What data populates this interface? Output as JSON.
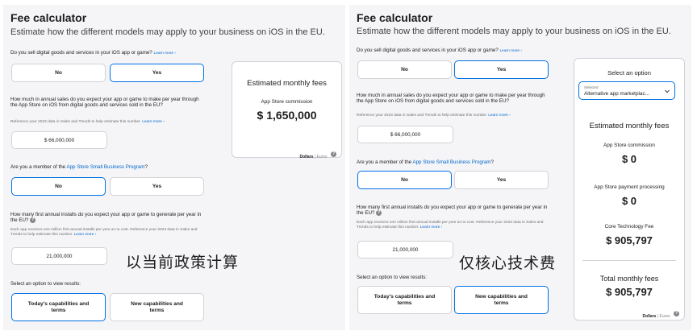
{
  "left": {
    "title": "Fee calculator",
    "subtitle": "Estimate how the different models may apply to your business on iOS in the EU.",
    "q1": "Do you sell digital goods and services in your iOS app or game?",
    "learn_more": "Learn more ›",
    "no": "No",
    "yes": "Yes",
    "q2": "How much in annual sales do you expect your app or game to make per year through the App Store on iOS from digital goods and services sold in the EU?",
    "ref2": "Reference your 2023 data in Sales and Trends to help estimate this number.",
    "sales_value": "$ 66,000,000",
    "q3_pre": "Are you a member of the ",
    "q3_link": "App Store Small Business Program",
    "q3_post": "?",
    "q4": "How many first annual installs do you expect your app or game to generate per year in the EU?",
    "ref4": "Each app receives one million first annual installs per year at no cost. Reference your 2023 data in Sales and Trends to help estimate this number.",
    "installs_value": "21,000,000",
    "q5": "Select an option to view results:",
    "opt1": "Today's capabilities and terms",
    "opt2": "New capabilities and terms",
    "card_heading": "Estimated monthly fees",
    "commission_label": "App Store commission",
    "commission_value": "$ 1,650,000",
    "currency_dollars": "Dollars",
    "currency_sep": " | ",
    "currency_euros": "Euros",
    "overlay": "以当前政策计算"
  },
  "right": {
    "title": "Fee calculator",
    "subtitle": "Estimate how the different models may apply to your business on iOS in the EU.",
    "q1": "Do you sell digital goods and services in your iOS app or game?",
    "learn_more": "Learn more ›",
    "no": "No",
    "yes": "Yes",
    "q2": "How much in annual sales do you expect your app or game to make per year through the App Store on iOS from digital goods and services sold in the EU?",
    "ref2": "Reference your 2023 data in Sales and Trends to help estimate this number.",
    "sales_value": "$ 66,000,000",
    "q3_pre": "Are you a member of the ",
    "q3_link": "App Store Small Business Program",
    "q3_post": "?",
    "q4": "How many first annual installs do you expect your app or game to generate per year in the EU?",
    "ref4": "Each app receives one million first annual installs per year at no cost. Reference your 2023 data in Sales and Trends to help estimate this number.",
    "installs_value": "21,000,000",
    "q5": "Select an option to view results:",
    "opt1": "Today's capabilities and terms",
    "opt2": "New capabilities and terms",
    "select_heading": "Select an option",
    "select_caption": "Selected",
    "select_value": "Alternative app marketplac...",
    "card_heading": "Estimated monthly fees",
    "commission_label": "App Store commission",
    "commission_value": "$ 0",
    "processing_label": "App Store payment processing",
    "processing_value": "$ 0",
    "ctf_label": "Core Technology Fee",
    "ctf_value": "$ 905,797",
    "total_label": "Total monthly fees",
    "total_value": "$ 905,797",
    "currency_dollars": "Dollars",
    "currency_sep": " | ",
    "currency_euros": "Euros",
    "overlay": "仅核心技术费"
  },
  "colors": {
    "accent": "#0071e3",
    "link": "#0066cc",
    "panel_bg": "#f5f5f7",
    "border": "#d2d2d7"
  }
}
